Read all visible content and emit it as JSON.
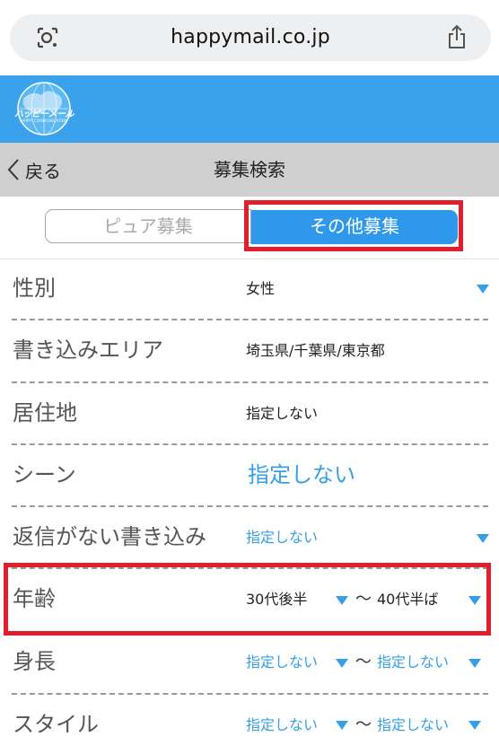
{
  "browser": {
    "url": "happymail.co.jp",
    "lens_icon": "lens-icon",
    "share_icon": "share-icon"
  },
  "header": {
    "logo_text": "ハッピーメール",
    "logo_sub": "HAPPY COMMUNICATION",
    "brand_color": "#3aa2ec"
  },
  "titlebar": {
    "back_label": "戻る",
    "title": "募集検索"
  },
  "tabs": [
    {
      "label": "ピュア募集",
      "active": false
    },
    {
      "label": "その他募集",
      "active": true
    }
  ],
  "form": {
    "gender": {
      "label": "性別",
      "value": "女性"
    },
    "area": {
      "label": "書き込みエリア",
      "value": "埼玉県/千葉県/東京都"
    },
    "residence": {
      "label": "居住地",
      "value": "指定しない"
    },
    "scene": {
      "label": "シーン",
      "value": "指定しない"
    },
    "no_reply": {
      "label": "返信がない書き込み",
      "value": "指定しない"
    },
    "age": {
      "label": "年齢",
      "from": "30代後半",
      "separator": "〜",
      "to": "40代半ば"
    },
    "height": {
      "label": "身長",
      "from": "指定しない",
      "separator": "〜",
      "to": "指定しない"
    },
    "style": {
      "label": "スタイル",
      "from": "指定しない",
      "separator": "〜",
      "to": "指定しない"
    }
  },
  "colors": {
    "accent_blue": "#2f98ea",
    "value_blue": "#35a0e6",
    "highlight_red": "#e01e2c"
  }
}
